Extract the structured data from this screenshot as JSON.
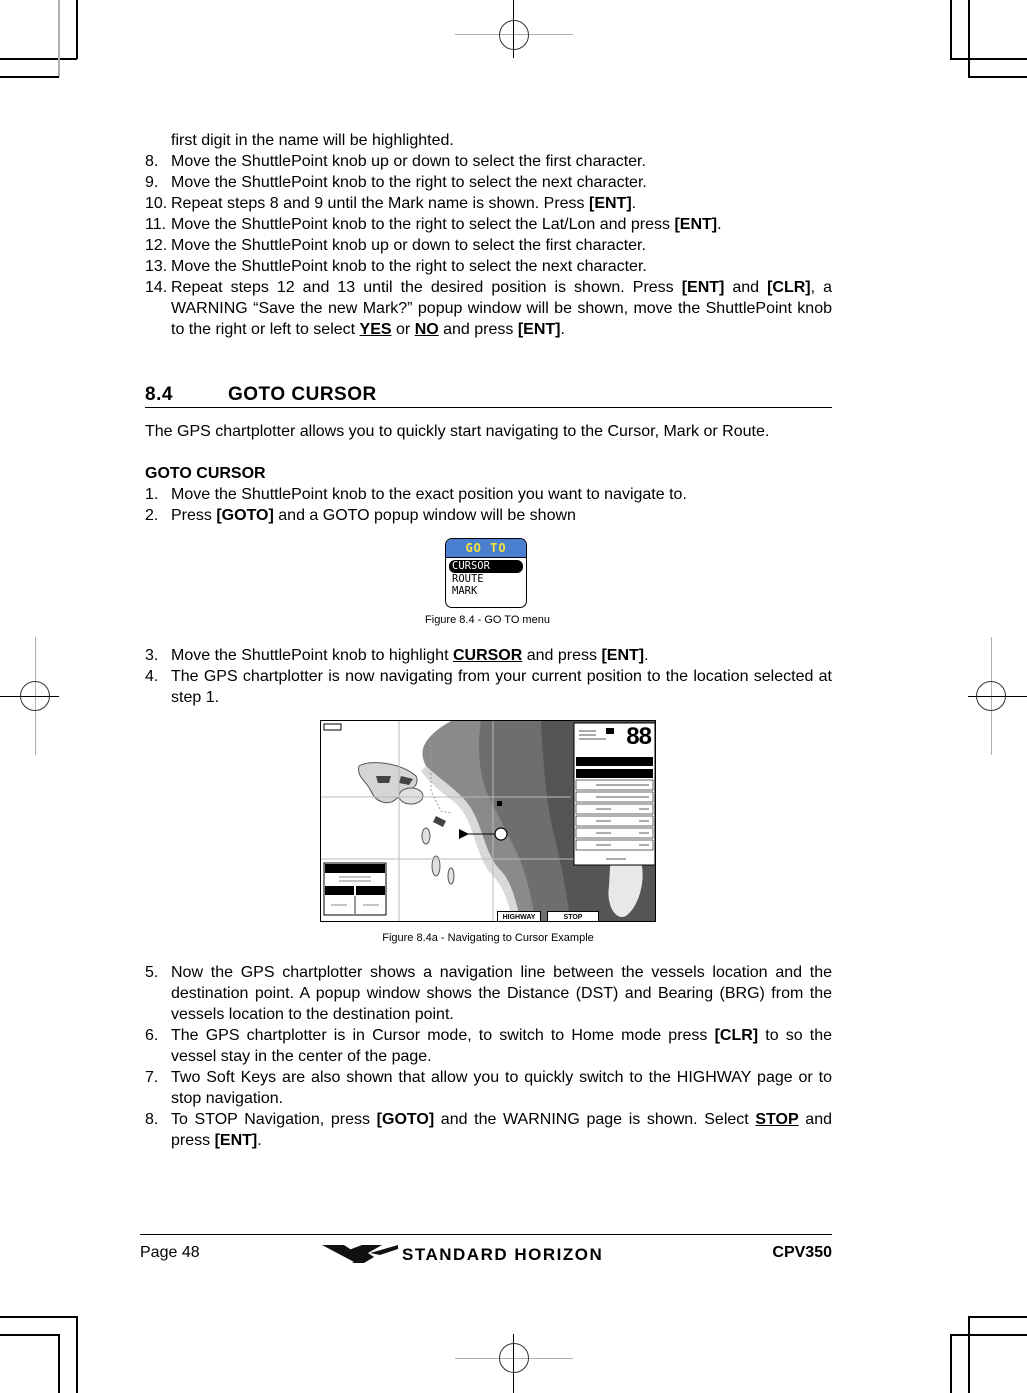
{
  "top_steps": {
    "continuation": "first digit in the name will be highlighted.",
    "items": [
      {
        "num": "8.",
        "parts": [
          {
            "t": "Move the ShuttlePoint knob up or down to select the first character."
          }
        ]
      },
      {
        "num": "9.",
        "parts": [
          {
            "t": "Move the ShuttlePoint knob to the right to select the next character."
          }
        ]
      },
      {
        "num": "10.",
        "parts": [
          {
            "t": "Repeat steps 8 and 9 until the Mark name is shown. Press "
          },
          {
            "t": "[ENT]",
            "s": "b"
          },
          {
            "t": "."
          }
        ]
      },
      {
        "num": "11.",
        "parts": [
          {
            "t": "Move the ShuttlePoint knob to the right to select the Lat/Lon and press "
          },
          {
            "t": "[ENT]",
            "s": "b"
          },
          {
            "t": "."
          }
        ]
      },
      {
        "num": "12.",
        "parts": [
          {
            "t": "Move the ShuttlePoint knob up or down to select the first character."
          }
        ]
      },
      {
        "num": "13.",
        "parts": [
          {
            "t": "Move the ShuttlePoint knob to the right to select the next character."
          }
        ]
      },
      {
        "num": "14.",
        "parts": [
          {
            "t": "Repeat steps 12 and 13 until the desired position is shown. Press "
          },
          {
            "t": "[ENT]",
            "s": "b"
          },
          {
            "t": " and "
          },
          {
            "t": "[CLR]",
            "s": "b"
          },
          {
            "t": ", a WARNING “Save the new Mark?” popup window will be shown, move the ShuttlePoint knob to the right or left to select "
          },
          {
            "t": "YES",
            "s": "u"
          },
          {
            "t": " or "
          },
          {
            "t": "NO",
            "s": "u"
          },
          {
            "t": " and press "
          },
          {
            "t": "[ENT]",
            "s": "b"
          },
          {
            "t": "."
          }
        ]
      }
    ]
  },
  "section": {
    "number": "8.4",
    "title": "GOTO CURSOR",
    "intro": "The GPS chartplotter allows you to quickly start navigating to the Cursor, Mark or Route.",
    "subheading": "GOTO CURSOR",
    "steps_a": [
      {
        "num": "1.",
        "parts": [
          {
            "t": "Move the ShuttlePoint knob to the exact position you want to navigate to."
          }
        ]
      },
      {
        "num": "2.",
        "parts": [
          {
            "t": "Press "
          },
          {
            "t": "[GOTO]",
            "s": "b"
          },
          {
            "t": " and a GOTO popup window will be shown"
          }
        ]
      }
    ],
    "steps_b": [
      {
        "num": "3.",
        "parts": [
          {
            "t": "Move the ShuttlePoint knob to highlight "
          },
          {
            "t": "CURSOR",
            "s": "u"
          },
          {
            "t": " and press "
          },
          {
            "t": "[ENT]",
            "s": "b"
          },
          {
            "t": "."
          }
        ]
      },
      {
        "num": "4.",
        "parts": [
          {
            "t": "The GPS chartplotter is now navigating from your current position to the location selected at step 1."
          }
        ]
      }
    ],
    "steps_c": [
      {
        "num": "5.",
        "parts": [
          {
            "t": "Now the GPS chartplotter shows a navigation line between the vessels location and the destination point. A popup window shows the Distance (DST) and Bearing (BRG) from the vessels location to the destination point."
          }
        ]
      },
      {
        "num": "6.",
        "parts": [
          {
            "t": "The GPS chartplotter is in Cursor mode, to switch to Home mode press "
          },
          {
            "t": "[CLR]",
            "s": "b"
          },
          {
            "t": " to so the vessel stay in the center of the page."
          }
        ]
      },
      {
        "num": "7.",
        "parts": [
          {
            "t": "Two Soft Keys are also shown that allow you to quickly switch to the HIGHWAY page or to stop navigation."
          }
        ]
      },
      {
        "num": "8.",
        "parts": [
          {
            "t": "To STOP Navigation, press "
          },
          {
            "t": "[GOTO]",
            "s": "b"
          },
          {
            "t": " and the WARNING page is shown. Select "
          },
          {
            "t": "STOP",
            "s": "u"
          },
          {
            "t": " and press "
          },
          {
            "t": "[ENT]",
            "s": "b"
          },
          {
            "t": "."
          }
        ]
      }
    ]
  },
  "goto_menu": {
    "title": "GO TO",
    "items": [
      "CURSOR",
      "ROUTE",
      "MARK"
    ],
    "selected": "CURSOR",
    "header_color": "#4a7fd0",
    "title_color": "#f5e23a",
    "caption": "Figure 8.4 - GO TO menu"
  },
  "map_figure": {
    "big_readout": "88",
    "softkeys": [
      "HIGHWAY",
      "STOP"
    ],
    "caption": "Figure 8.4a -  Navigating to Cursor Example"
  },
  "footer": {
    "page": "Page 48",
    "brand": "STANDARD HORIZON",
    "model": "CPV350"
  }
}
